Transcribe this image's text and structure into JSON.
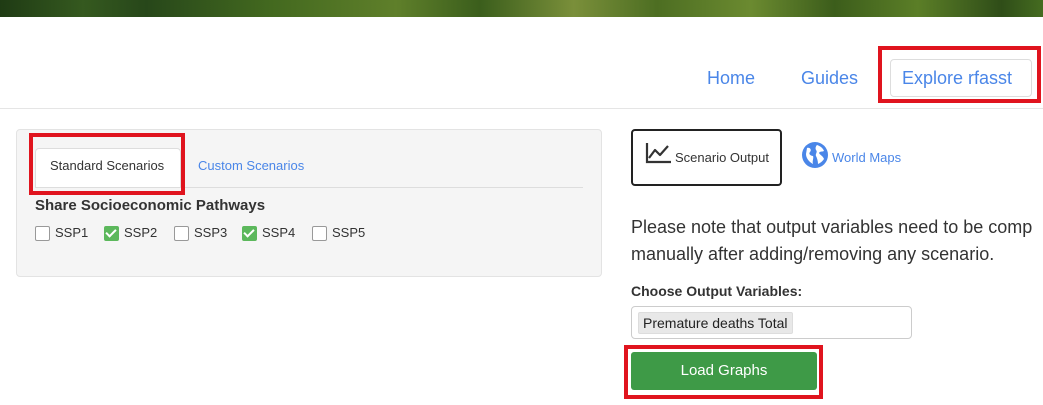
{
  "nav": {
    "home": "Home",
    "guides": "Guides",
    "explore": "Explore rfasst"
  },
  "left_panel": {
    "tabs": {
      "standard": "Standard Scenarios",
      "custom": "Custom Scenarios"
    },
    "heading": "Share Socioeconomic Pathways",
    "checkboxes": [
      {
        "label": "SSP1",
        "checked": false
      },
      {
        "label": "SSP2",
        "checked": true
      },
      {
        "label": "SSP3",
        "checked": false
      },
      {
        "label": "SSP4",
        "checked": true
      },
      {
        "label": "SSP5",
        "checked": false
      }
    ]
  },
  "right_panel": {
    "tabs": {
      "output": "Scenario Output",
      "maps": "World Maps"
    },
    "note_line1": "Please note that output variables need to be comp",
    "note_line2": "manually after adding/removing any scenario.",
    "choose_label": "Choose Output Variables:",
    "selected_variable": "Premature deaths Total",
    "load_button": "Load Graphs"
  },
  "colors": {
    "link": "#4a86e8",
    "checkbox_checked": "#5cb85c",
    "load_button": "#3e9a47",
    "highlight": "#e0141e"
  },
  "icons": [
    "chart-line-icon",
    "globe-icon",
    "check-icon"
  ]
}
